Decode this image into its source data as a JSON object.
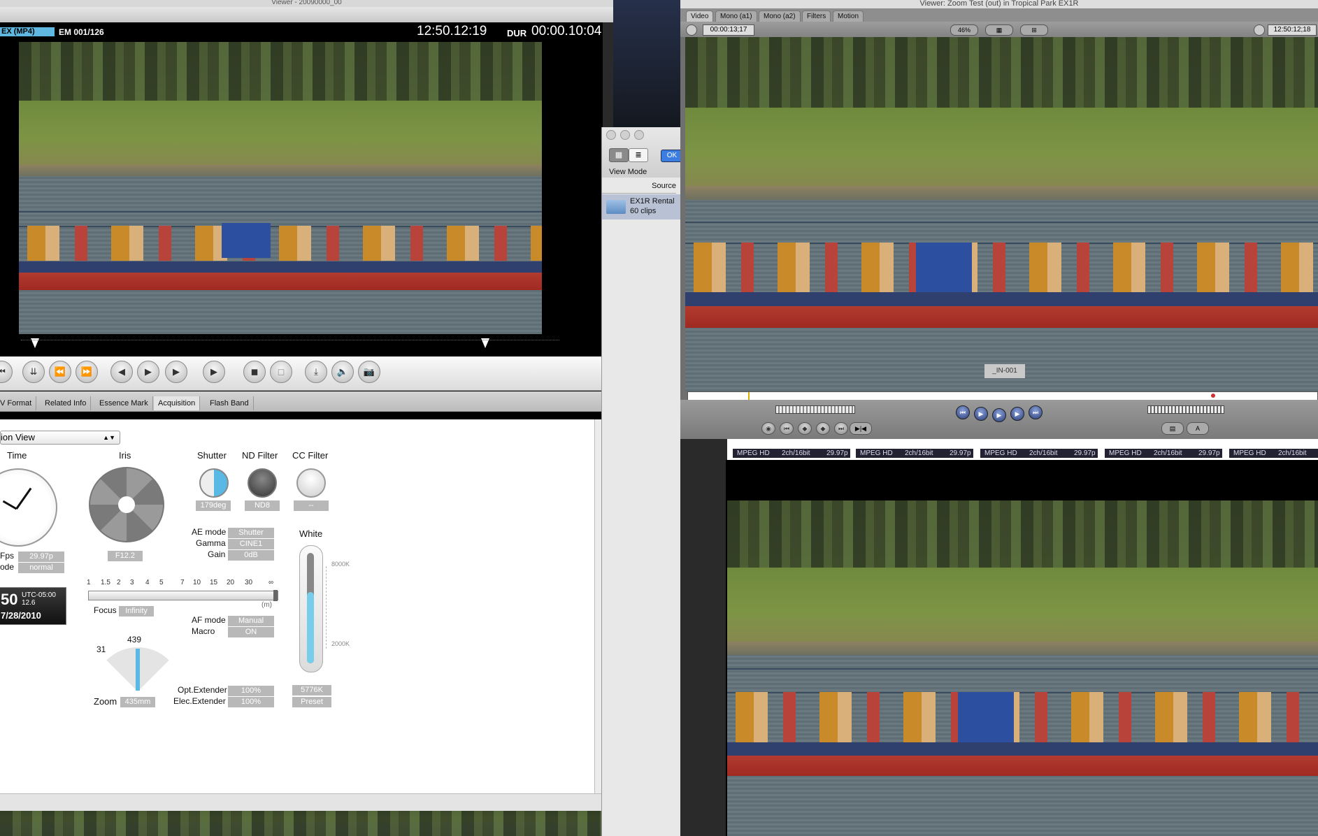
{
  "left_window": {
    "title": "Viewer - 20090000_00",
    "osd": {
      "format": "EX (MP4)",
      "clip_counter": "EM 001/126",
      "timecode": "12:50.12:19",
      "dur_label": "DUR",
      "duration": "00:00.10:04"
    },
    "tabs": [
      "V Format",
      "Related Info",
      "Essence Mark",
      "Acquisition",
      "Flash Band"
    ],
    "view_select": "ion View",
    "acquisition": {
      "time_label": "Time",
      "iris_label": "Iris",
      "iris_value": "F12.2",
      "shutter_label": "Shutter",
      "shutter_value": "179deg",
      "nd_label": "ND Filter",
      "nd_value": "ND8",
      "cc_label": "CC Filter",
      "cc_value": "--",
      "fps_label": "Fps",
      "fps_value": "29.97p",
      "mode_label": "ode",
      "mode_value": "normal",
      "date_time": "50",
      "utc": "UTC-05:00",
      "utc_sub": "12.6",
      "date": "7/28/2010",
      "ae_mode_label": "AE mode",
      "ae_mode_value": "Shutter",
      "gamma_label": "Gamma",
      "gamma_value": "CINE1",
      "gain_label": "Gain",
      "gain_value": "0dB",
      "focus_ticks": [
        "1",
        "1.5",
        "2",
        "3",
        "4",
        "5",
        "7",
        "10",
        "15",
        "20",
        "30",
        "∞"
      ],
      "focus_unit": "(m)",
      "focus_label": "Focus",
      "focus_value": "Infinity",
      "af_mode_label": "AF mode",
      "af_mode_value": "Manual",
      "macro_label": "Macro",
      "macro_value": "ON",
      "zoom_min": "31",
      "zoom_max": "439",
      "zoom_label": "Zoom",
      "zoom_value": "435mm",
      "opt_ext_label": "Opt.Extender",
      "opt_ext_value": "100%",
      "elec_ext_label": "Elec.Extender",
      "elec_ext_value": "100%",
      "white_label": "White",
      "white_high": "8000K",
      "white_low": "2000K",
      "white_value": "5776K",
      "white_mode": "Preset"
    }
  },
  "browser": {
    "view_mode_label": "View Mode",
    "ok_label": "OK",
    "source_header": "Source",
    "item_name": "EX1R Rental",
    "item_count": "60 clips"
  },
  "viewer": {
    "title": "Viewer: Zoom Test (out) in Tropical Park EX1R",
    "tabs": [
      "Video",
      "Mono (a1)",
      "Mono (a2)",
      "Filters",
      "Motion"
    ],
    "duration_tc": "00:00:13;17",
    "zoom": "46%",
    "current_tc": "12:50:12;18",
    "overlay_label": "_IN-001"
  },
  "timeline": {
    "clips": [
      {
        "codec": "MPEG HD",
        "audio": "2ch/16bit",
        "rate": "29.97p"
      },
      {
        "codec": "MPEG HD",
        "audio": "2ch/16bit",
        "rate": "29.97p"
      },
      {
        "codec": "MPEG HD",
        "audio": "2ch/16bit",
        "rate": "29.97p"
      },
      {
        "codec": "MPEG HD",
        "audio": "2ch/16bit",
        "rate": "29.97p"
      },
      {
        "codec": "MPEG HD",
        "audio": "2ch/16bit",
        "rate": ""
      }
    ]
  }
}
